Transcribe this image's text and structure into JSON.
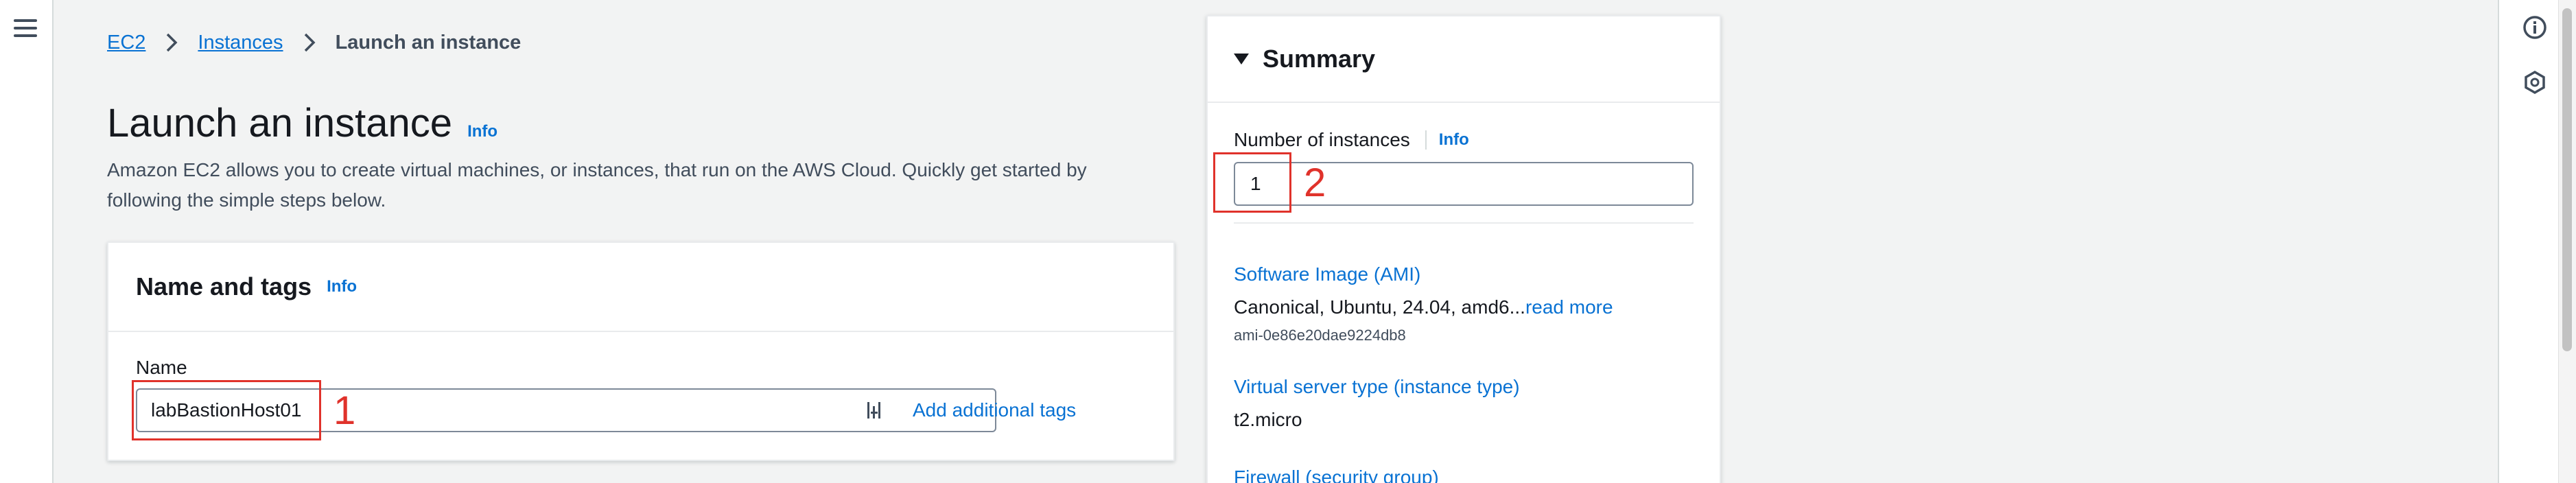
{
  "breadcrumb": {
    "items": [
      "EC2",
      "Instances"
    ],
    "current": "Launch an instance"
  },
  "page": {
    "title": "Launch an instance",
    "info": "Info",
    "description": "Amazon EC2 allows you to create virtual machines, or instances, that run on the AWS Cloud. Quickly get started by following the simple steps below."
  },
  "name_and_tags": {
    "title": "Name and tags",
    "info": "Info",
    "name_label": "Name",
    "name_value": "labBastionHost01",
    "add_tags": "Add additional tags"
  },
  "summary": {
    "title": "Summary",
    "instances_label": "Number of instances",
    "instances_info": "Info",
    "instances_value": "1",
    "ami_label": "Software Image (AMI)",
    "ami_value": "Canonical, Ubuntu, 24.04, amd6...",
    "ami_read_more": "read more",
    "ami_id": "ami-0e86e20dae9224db8",
    "instance_type_label": "Virtual server type (instance type)",
    "instance_type_value": "t2.micro",
    "firewall_label": "Firewall (security group)"
  },
  "annotations": {
    "one": "1",
    "two": "2"
  },
  "icons": {
    "menu": "hamburger-menu-icon",
    "info": "info-circle-icon",
    "settings": "hexagon-settings-icon",
    "separator": "chevron-right-icon",
    "collapse": "caret-down-icon",
    "input_suffix": "input-suffix-icon"
  },
  "colors": {
    "link": "#0972d3",
    "annotation": "#e0322b",
    "background": "#f2f3f3"
  }
}
